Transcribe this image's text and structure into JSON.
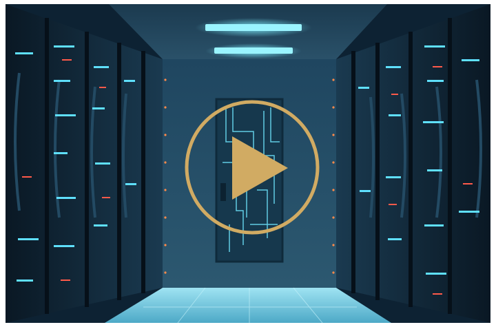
{
  "video_player": {
    "thumbnail_subject": "server-room-corridor",
    "overlay_icon": "play-icon",
    "colors": {
      "play_accent": "#d1ab63",
      "scene_dark": "#0d2233",
      "scene_mid": "#2b5a73",
      "neon_cyan": "#5fe0ff",
      "led_red": "#ff5a4a",
      "ceiling_light": "#7ef0ff"
    }
  }
}
